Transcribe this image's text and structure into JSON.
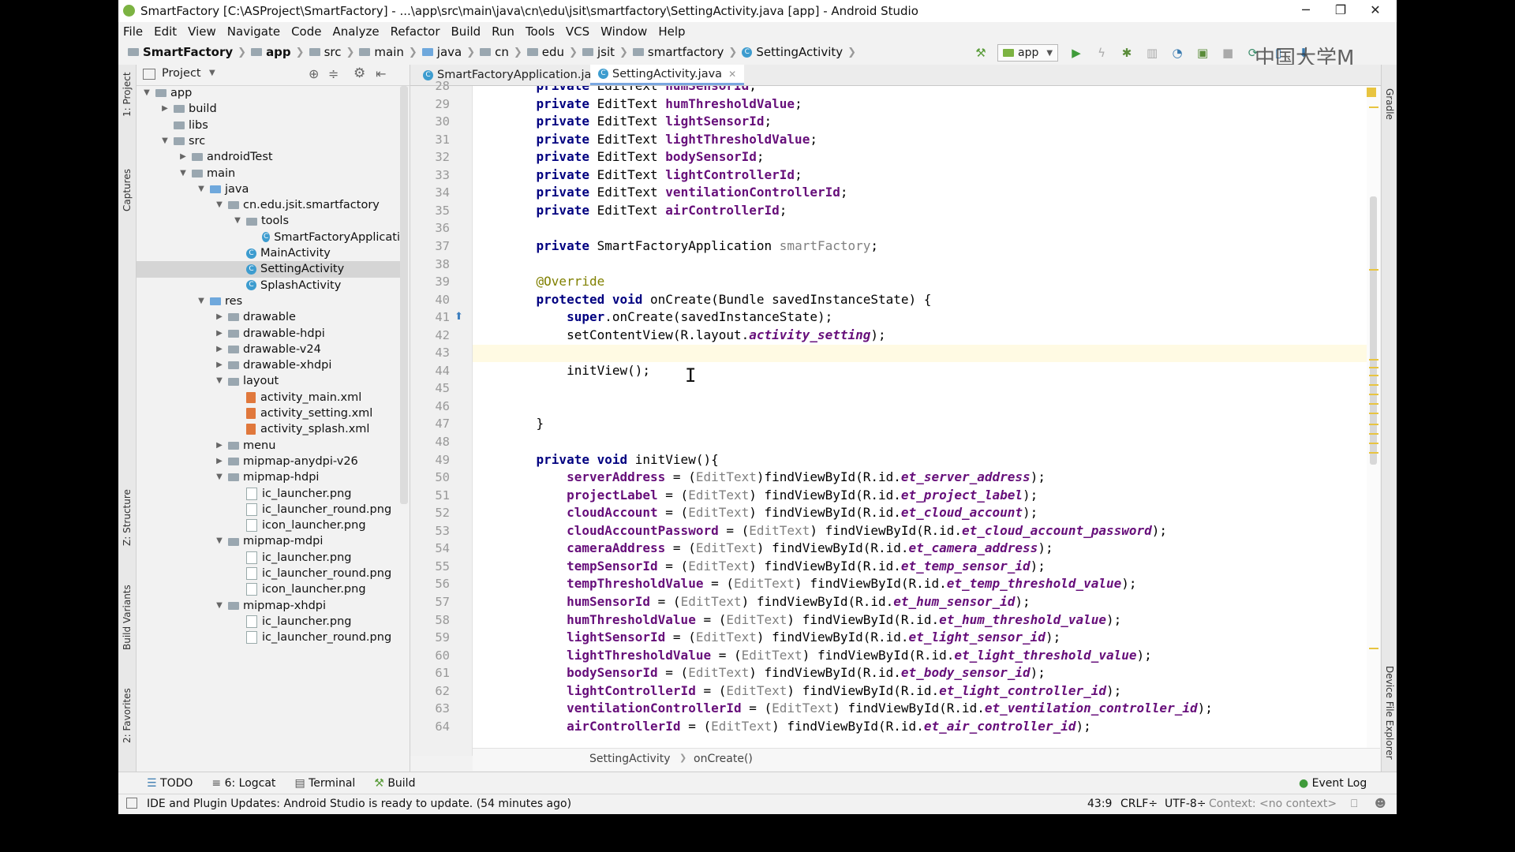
{
  "window": {
    "title": "SmartFactory [C:\\ASProject\\SmartFactory] - ...\\app\\src\\main\\java\\cn\\edu\\jsit\\smartfactory\\SettingActivity.java [app] - Android Studio",
    "minimize": "─",
    "restore": "❐",
    "close": "✕"
  },
  "menu": [
    "File",
    "Edit",
    "View",
    "Navigate",
    "Code",
    "Analyze",
    "Refactor",
    "Build",
    "Run",
    "Tools",
    "VCS",
    "Window",
    "Help"
  ],
  "breadcrumbs": [
    "SmartFactory",
    "app",
    "src",
    "main",
    "java",
    "cn",
    "edu",
    "jsit",
    "smartfactory",
    "SettingActivity"
  ],
  "toolbar": {
    "run_config": "app",
    "watermark": "中国大学M"
  },
  "side_tabs": {
    "project": "1: Project",
    "captures": "Captures",
    "structure": "Z: Structure",
    "build_variants": "Build Variants",
    "favorites": "2: Favorites",
    "gradle": "Gradle",
    "device_explorer": "Device File Explorer"
  },
  "project_panel": {
    "title": "Project",
    "tree": [
      {
        "label": "app",
        "type": "folder",
        "exp": "open"
      },
      {
        "label": "build",
        "type": "folder",
        "exp": "closed"
      },
      {
        "label": "libs",
        "type": "folder",
        "exp": "none"
      },
      {
        "label": "src",
        "type": "folder",
        "exp": "open"
      },
      {
        "label": "androidTest",
        "type": "folder",
        "exp": "closed"
      },
      {
        "label": "main",
        "type": "folder",
        "exp": "open"
      },
      {
        "label": "java",
        "type": "folder",
        "exp": "open"
      },
      {
        "label": "cn.edu.jsit.smartfactory",
        "type": "folder",
        "exp": "open"
      },
      {
        "label": "tools",
        "type": "folder",
        "exp": "open"
      },
      {
        "label": "SmartFactoryApplicati",
        "type": "class",
        "exp": "none"
      },
      {
        "label": "MainActivity",
        "type": "class",
        "exp": "none"
      },
      {
        "label": "SettingActivity",
        "type": "class",
        "exp": "none",
        "selected": true
      },
      {
        "label": "SplashActivity",
        "type": "class",
        "exp": "none"
      },
      {
        "label": "res",
        "type": "folder",
        "exp": "open"
      },
      {
        "label": "drawable",
        "type": "folder",
        "exp": "closed"
      },
      {
        "label": "drawable-hdpi",
        "type": "folder",
        "exp": "closed"
      },
      {
        "label": "drawable-v24",
        "type": "folder",
        "exp": "closed"
      },
      {
        "label": "drawable-xhdpi",
        "type": "folder",
        "exp": "closed"
      },
      {
        "label": "layout",
        "type": "folder",
        "exp": "open"
      },
      {
        "label": "activity_main.xml",
        "type": "xml",
        "exp": "none"
      },
      {
        "label": "activity_setting.xml",
        "type": "xml",
        "exp": "none"
      },
      {
        "label": "activity_splash.xml",
        "type": "xml",
        "exp": "none"
      },
      {
        "label": "menu",
        "type": "folder",
        "exp": "closed"
      },
      {
        "label": "mipmap-anydpi-v26",
        "type": "folder",
        "exp": "closed"
      },
      {
        "label": "mipmap-hdpi",
        "type": "folder",
        "exp": "open"
      },
      {
        "label": "ic_launcher.png",
        "type": "file",
        "exp": "none"
      },
      {
        "label": "ic_launcher_round.png",
        "type": "file",
        "exp": "none"
      },
      {
        "label": "icon_launcher.png",
        "type": "file",
        "exp": "none"
      },
      {
        "label": "mipmap-mdpi",
        "type": "folder",
        "exp": "open"
      },
      {
        "label": "ic_launcher.png",
        "type": "file",
        "exp": "none"
      },
      {
        "label": "ic_launcher_round.png",
        "type": "file",
        "exp": "none"
      },
      {
        "label": "icon_launcher.png",
        "type": "file",
        "exp": "none"
      },
      {
        "label": "mipmap-xhdpi",
        "type": "folder",
        "exp": "open"
      },
      {
        "label": "ic_launcher.png",
        "type": "file",
        "exp": "none"
      },
      {
        "label": "ic_launcher_round.png",
        "type": "file",
        "exp": "none"
      }
    ]
  },
  "tabs": [
    {
      "label": "SmartFactoryApplication.java",
      "active": false
    },
    {
      "label": "SettingActivity.java",
      "active": true
    }
  ],
  "editor": {
    "current_line": 43,
    "lines": [
      {
        "n": 28,
        "t": [
          [
            "    ",
            ""
          ],
          [
            "private",
            "kw"
          ],
          [
            " EditText ",
            ""
          ],
          [
            "humSensorId",
            "field"
          ],
          [
            ";",
            ""
          ]
        ]
      },
      {
        "n": 29,
        "t": [
          [
            "    ",
            ""
          ],
          [
            "private",
            "kw"
          ],
          [
            " EditText ",
            ""
          ],
          [
            "humThresholdValue",
            "field"
          ],
          [
            ";",
            ""
          ]
        ]
      },
      {
        "n": 30,
        "t": [
          [
            "    ",
            ""
          ],
          [
            "private",
            "kw"
          ],
          [
            " EditText ",
            ""
          ],
          [
            "lightSensorId",
            "field"
          ],
          [
            ";",
            ""
          ]
        ]
      },
      {
        "n": 31,
        "t": [
          [
            "    ",
            ""
          ],
          [
            "private",
            "kw"
          ],
          [
            " EditText ",
            ""
          ],
          [
            "lightThresholdValue",
            "field"
          ],
          [
            ";",
            ""
          ]
        ]
      },
      {
        "n": 32,
        "t": [
          [
            "    ",
            ""
          ],
          [
            "private",
            "kw"
          ],
          [
            " EditText ",
            ""
          ],
          [
            "bodySensorId",
            "field"
          ],
          [
            ";",
            ""
          ]
        ]
      },
      {
        "n": 33,
        "t": [
          [
            "    ",
            ""
          ],
          [
            "private",
            "kw"
          ],
          [
            " EditText ",
            ""
          ],
          [
            "lightControllerId",
            "field"
          ],
          [
            ";",
            ""
          ]
        ]
      },
      {
        "n": 34,
        "t": [
          [
            "    ",
            ""
          ],
          [
            "private",
            "kw"
          ],
          [
            " EditText ",
            ""
          ],
          [
            "ventilationControllerId",
            "field"
          ],
          [
            ";",
            ""
          ]
        ]
      },
      {
        "n": 35,
        "t": [
          [
            "    ",
            ""
          ],
          [
            "private",
            "kw"
          ],
          [
            " EditText ",
            ""
          ],
          [
            "airControllerId",
            "field"
          ],
          [
            ";",
            ""
          ]
        ]
      },
      {
        "n": 36,
        "t": []
      },
      {
        "n": 37,
        "t": [
          [
            "    ",
            ""
          ],
          [
            "private",
            "kw"
          ],
          [
            " SmartFactoryApplication ",
            ""
          ],
          [
            "smartFactory",
            "grey"
          ],
          [
            ";",
            ""
          ]
        ]
      },
      {
        "n": 38,
        "t": []
      },
      {
        "n": 39,
        "t": [
          [
            "    ",
            ""
          ],
          [
            "@Override",
            "ann"
          ]
        ]
      },
      {
        "n": 40,
        "t": [
          [
            "    ",
            ""
          ],
          [
            "protected void",
            "kw"
          ],
          [
            " onCreate(Bundle savedInstanceState) {",
            ""
          ]
        ]
      },
      {
        "n": 41,
        "t": [
          [
            "        ",
            ""
          ],
          [
            "super",
            "kw"
          ],
          [
            ".onCreate(savedInstanceState);",
            ""
          ]
        ]
      },
      {
        "n": 42,
        "t": [
          [
            "        setContentView(R.layout.",
            ""
          ],
          [
            "activity_setting",
            "st"
          ],
          [
            ");",
            ""
          ]
        ]
      },
      {
        "n": 43,
        "t": []
      },
      {
        "n": 44,
        "t": [
          [
            "        initView();",
            ""
          ]
        ]
      },
      {
        "n": 45,
        "t": []
      },
      {
        "n": 46,
        "t": []
      },
      {
        "n": 47,
        "t": [
          [
            "    }",
            ""
          ]
        ]
      },
      {
        "n": 48,
        "t": []
      },
      {
        "n": 49,
        "t": [
          [
            "    ",
            ""
          ],
          [
            "private void",
            "kw"
          ],
          [
            " initView(){",
            ""
          ]
        ]
      },
      {
        "n": 50,
        "t": [
          [
            "        ",
            ""
          ],
          [
            "serverAddress",
            "field"
          ],
          [
            " = (",
            ""
          ],
          [
            "EditText",
            "cast"
          ],
          [
            ")findViewById(R.id.",
            ""
          ],
          [
            "et_server_address",
            "st"
          ],
          [
            ");",
            ""
          ]
        ]
      },
      {
        "n": 51,
        "t": [
          [
            "        ",
            ""
          ],
          [
            "projectLabel",
            "field"
          ],
          [
            " = (",
            ""
          ],
          [
            "EditText",
            "cast"
          ],
          [
            ") findViewById(R.id.",
            ""
          ],
          [
            "et_project_label",
            "st"
          ],
          [
            ");",
            ""
          ]
        ]
      },
      {
        "n": 52,
        "t": [
          [
            "        ",
            ""
          ],
          [
            "cloudAccount",
            "field"
          ],
          [
            " = (",
            ""
          ],
          [
            "EditText",
            "cast"
          ],
          [
            ") findViewById(R.id.",
            ""
          ],
          [
            "et_cloud_account",
            "st"
          ],
          [
            ");",
            ""
          ]
        ]
      },
      {
        "n": 53,
        "t": [
          [
            "        ",
            ""
          ],
          [
            "cloudAccountPassword",
            "field"
          ],
          [
            " = (",
            ""
          ],
          [
            "EditText",
            "cast"
          ],
          [
            ") findViewById(R.id.",
            ""
          ],
          [
            "et_cloud_account_password",
            "st"
          ],
          [
            ");",
            ""
          ]
        ]
      },
      {
        "n": 54,
        "t": [
          [
            "        ",
            ""
          ],
          [
            "cameraAddress",
            "field"
          ],
          [
            " = (",
            ""
          ],
          [
            "EditText",
            "cast"
          ],
          [
            ") findViewById(R.id.",
            ""
          ],
          [
            "et_camera_address",
            "st"
          ],
          [
            ");",
            ""
          ]
        ]
      },
      {
        "n": 55,
        "t": [
          [
            "        ",
            ""
          ],
          [
            "tempSensorId",
            "field"
          ],
          [
            " = (",
            ""
          ],
          [
            "EditText",
            "cast"
          ],
          [
            ") findViewById(R.id.",
            ""
          ],
          [
            "et_temp_sensor_id",
            "st"
          ],
          [
            ");",
            ""
          ]
        ]
      },
      {
        "n": 56,
        "t": [
          [
            "        ",
            ""
          ],
          [
            "tempThresholdValue",
            "field"
          ],
          [
            " = (",
            ""
          ],
          [
            "EditText",
            "cast"
          ],
          [
            ") findViewById(R.id.",
            ""
          ],
          [
            "et_temp_threshold_value",
            "st"
          ],
          [
            ");",
            ""
          ]
        ]
      },
      {
        "n": 57,
        "t": [
          [
            "        ",
            ""
          ],
          [
            "humSensorId",
            "field"
          ],
          [
            " = (",
            ""
          ],
          [
            "EditText",
            "cast"
          ],
          [
            ") findViewById(R.id.",
            ""
          ],
          [
            "et_hum_sensor_id",
            "st"
          ],
          [
            ");",
            ""
          ]
        ]
      },
      {
        "n": 58,
        "t": [
          [
            "        ",
            ""
          ],
          [
            "humThresholdValue",
            "field"
          ],
          [
            " = (",
            ""
          ],
          [
            "EditText",
            "cast"
          ],
          [
            ") findViewById(R.id.",
            ""
          ],
          [
            "et_hum_threshold_value",
            "st"
          ],
          [
            ");",
            ""
          ]
        ]
      },
      {
        "n": 59,
        "t": [
          [
            "        ",
            ""
          ],
          [
            "lightSensorId",
            "field"
          ],
          [
            " = (",
            ""
          ],
          [
            "EditText",
            "cast"
          ],
          [
            ") findViewById(R.id.",
            ""
          ],
          [
            "et_light_sensor_id",
            "st"
          ],
          [
            ");",
            ""
          ]
        ]
      },
      {
        "n": 60,
        "t": [
          [
            "        ",
            ""
          ],
          [
            "lightThresholdValue",
            "field"
          ],
          [
            " = (",
            ""
          ],
          [
            "EditText",
            "cast"
          ],
          [
            ") findViewById(R.id.",
            ""
          ],
          [
            "et_light_threshold_value",
            "st"
          ],
          [
            ");",
            ""
          ]
        ]
      },
      {
        "n": 61,
        "t": [
          [
            "        ",
            ""
          ],
          [
            "bodySensorId",
            "field"
          ],
          [
            " = (",
            ""
          ],
          [
            "EditText",
            "cast"
          ],
          [
            ") findViewById(R.id.",
            ""
          ],
          [
            "et_body_sensor_id",
            "st"
          ],
          [
            ");",
            ""
          ]
        ]
      },
      {
        "n": 62,
        "t": [
          [
            "        ",
            ""
          ],
          [
            "lightControllerId",
            "field"
          ],
          [
            " = (",
            ""
          ],
          [
            "EditText",
            "cast"
          ],
          [
            ") findViewById(R.id.",
            ""
          ],
          [
            "et_light_controller_id",
            "st"
          ],
          [
            ");",
            ""
          ]
        ]
      },
      {
        "n": 63,
        "t": [
          [
            "        ",
            ""
          ],
          [
            "ventilationControllerId",
            "field"
          ],
          [
            " = (",
            ""
          ],
          [
            "EditText",
            "cast"
          ],
          [
            ") findViewById(R.id.",
            ""
          ],
          [
            "et_ventilation_controller_id",
            "st"
          ],
          [
            ");",
            ""
          ]
        ]
      },
      {
        "n": 64,
        "t": [
          [
            "        ",
            ""
          ],
          [
            "airControllerId",
            "field"
          ],
          [
            " = (",
            ""
          ],
          [
            "EditText",
            "cast"
          ],
          [
            ") findViewById(R.id.",
            ""
          ],
          [
            "et_air_controller_id",
            "st"
          ],
          [
            ");",
            ""
          ]
        ]
      }
    ]
  },
  "editor_breadcrumb": [
    "SettingActivity",
    "onCreate()"
  ],
  "tool_windows": {
    "todo": "TODO",
    "logcat": "6: Logcat",
    "terminal": "Terminal",
    "build": "Build",
    "event_log": "Event Log"
  },
  "status": {
    "message": "IDE and Plugin Updates: Android Studio is ready to update. (54 minutes ago)",
    "position": "43:9",
    "line_sep": "CRLF÷",
    "encoding": "UTF-8÷",
    "context": "Context: <no context>"
  }
}
